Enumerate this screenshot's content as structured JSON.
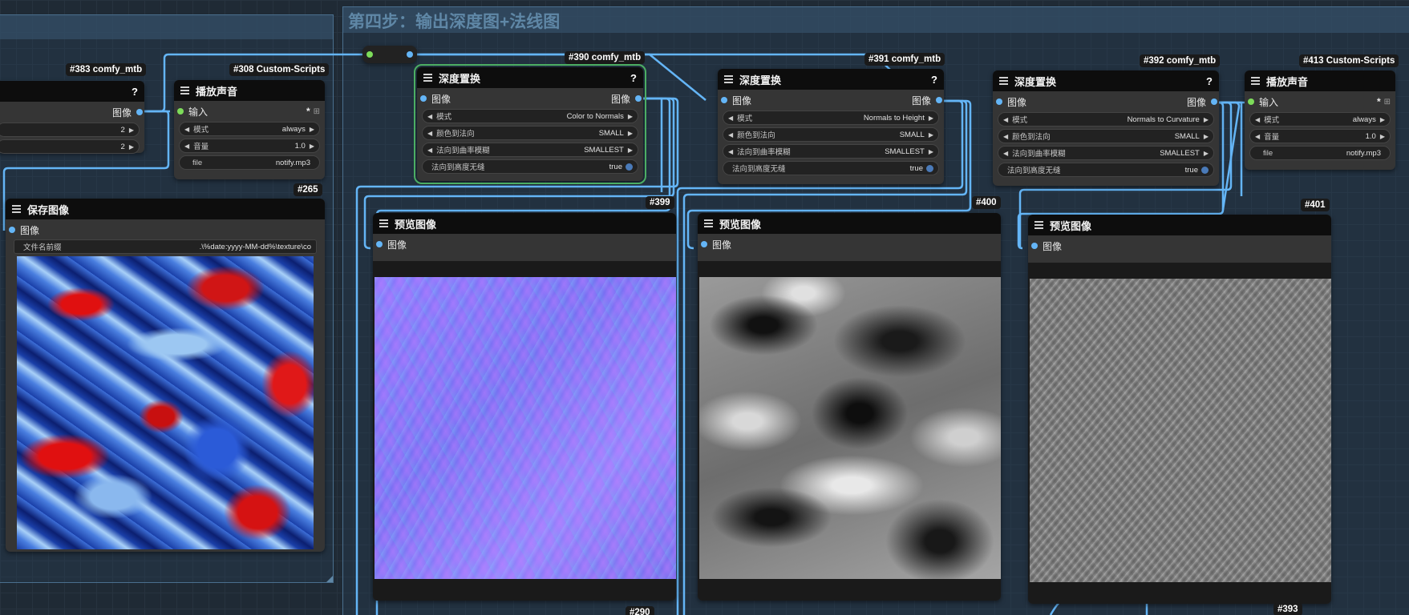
{
  "group": {
    "title": "第四步：输出深度图+法线图"
  },
  "nodes": {
    "n383": {
      "badge": "#383 comfy_mtb",
      "help": "?",
      "output_label": "图像",
      "widgets": [
        {
          "value": "2"
        },
        {
          "value": "2"
        }
      ]
    },
    "n308": {
      "badge": "#308 Custom-Scripts",
      "title": "播放声音",
      "input_label": "输入",
      "star": "*",
      "widgets": [
        {
          "name": "模式",
          "value": "always"
        },
        {
          "name": "音量",
          "value": "1.0"
        }
      ],
      "file": {
        "name": "file",
        "value": "notify.mp3"
      }
    },
    "n265": {
      "badge": "#265",
      "title": "保存图像",
      "input_label": "图像",
      "prefix": {
        "name": "文件名前缀",
        "value": ".\\%date:yyyy-MM-dd%\\texture\\co"
      }
    },
    "n390": {
      "badge": "#390 comfy_mtb",
      "title": "深度置换",
      "help": "?",
      "input_label": "图像",
      "output_label": "图像",
      "widgets": [
        {
          "name": "模式",
          "value": "Color to Normals"
        },
        {
          "name": "颜色到法向",
          "value": "SMALL"
        },
        {
          "name": "法向到曲率模糊",
          "value": "SMALLEST"
        },
        {
          "name": "法向到高度无缝",
          "value": "true"
        }
      ]
    },
    "n391": {
      "badge": "#391 comfy_mtb",
      "title": "深度置换",
      "help": "?",
      "input_label": "图像",
      "output_label": "图像",
      "widgets": [
        {
          "name": "模式",
          "value": "Normals to Height"
        },
        {
          "name": "颜色到法向",
          "value": "SMALL"
        },
        {
          "name": "法向到曲率模糊",
          "value": "SMALLEST"
        },
        {
          "name": "法向到高度无缝",
          "value": "true"
        }
      ]
    },
    "n392": {
      "badge": "#392 comfy_mtb",
      "title": "深度置换",
      "help": "?",
      "input_label": "图像",
      "output_label": "图像",
      "widgets": [
        {
          "name": "模式",
          "value": "Normals to Curvature"
        },
        {
          "name": "颜色到法向",
          "value": "SMALL"
        },
        {
          "name": "法向到曲率模糊",
          "value": "SMALLEST"
        },
        {
          "name": "法向到高度无缝",
          "value": "true"
        }
      ]
    },
    "n413": {
      "badge": "#413 Custom-Scripts",
      "title": "播放声音",
      "input_label": "输入",
      "star": "*",
      "widgets": [
        {
          "name": "模式",
          "value": "always"
        },
        {
          "name": "音量",
          "value": "1.0"
        }
      ],
      "file": {
        "name": "file",
        "value": "notify.mp3"
      }
    },
    "n399": {
      "badge": "#399",
      "title": "预览图像",
      "input_label": "图像"
    },
    "n400": {
      "badge": "#400",
      "title": "预览图像",
      "input_label": "图像"
    },
    "n401": {
      "badge": "#401",
      "title": "预览图像",
      "input_label": "图像"
    },
    "n290": {
      "badge": "#290"
    },
    "n393": {
      "badge": "#393"
    }
  },
  "colors": {
    "wire": "#64b5f6",
    "node_bg": "#353535",
    "header_bg": "#0d0d0d",
    "group_title": "#5f87a6",
    "selected": "#4cae63"
  }
}
